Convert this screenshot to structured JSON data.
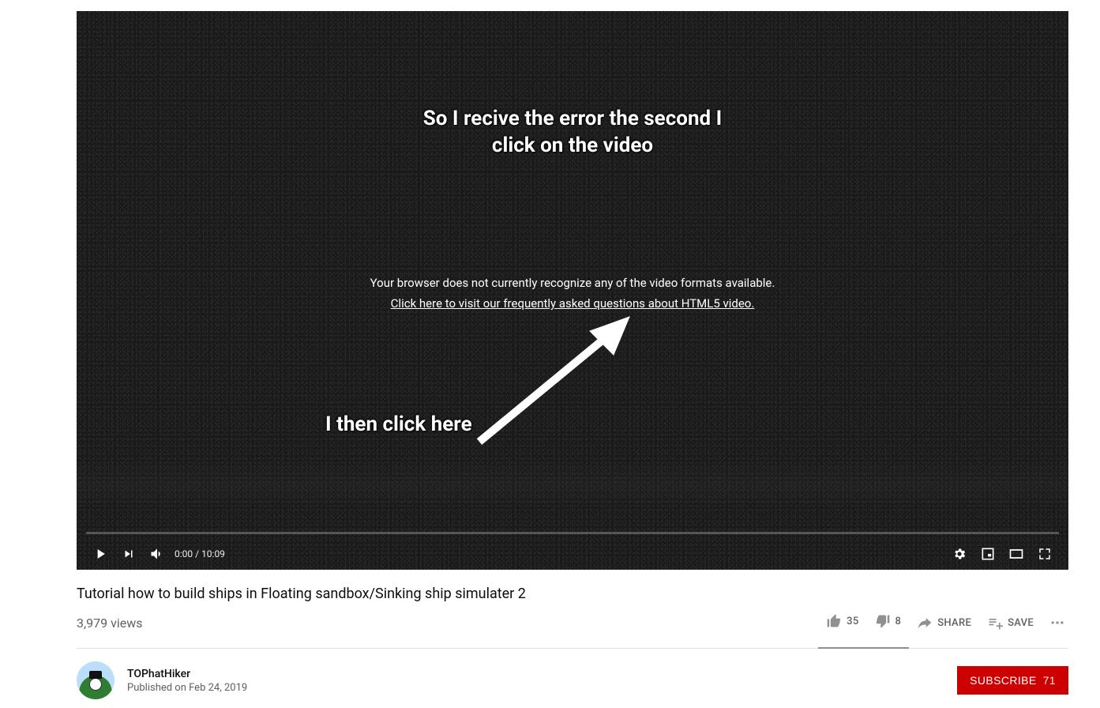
{
  "player": {
    "annotation_top_line1": "So I recive the error the second I",
    "annotation_top_line2": "click on the video",
    "error_line1": "Your browser does not currently recognize any of the video formats available.",
    "error_link_text": "Click here to visit our frequently asked questions about HTML5 video.",
    "annotation_bottom": "I then click here",
    "time_current": "0:00",
    "time_separator": " / ",
    "time_total": "10:09"
  },
  "video": {
    "title": "Tutorial how to build ships in Floating sandbox/Sinking ship simulater 2",
    "views_text": "3,979 views",
    "likes": "35",
    "dislikes": "8",
    "share_label": "SHARE",
    "save_label": "SAVE"
  },
  "channel": {
    "name": "TOPhatHiker",
    "published_text": "Published on Feb 24, 2019",
    "subscribe_label": "SUBSCRIBE",
    "subscriber_count": "71"
  }
}
